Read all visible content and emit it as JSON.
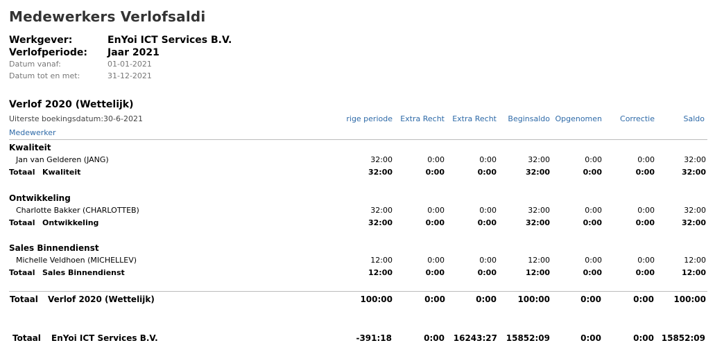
{
  "title": "Medewerkers Verlofsaldi",
  "meta": {
    "werkgever_label": "Werkgever:",
    "werkgever_value": "EnYoi ICT Services B.V.",
    "periode_label": "Verlofperiode:",
    "periode_value": "Jaar 2021",
    "van_label": "Datum vanaf:",
    "van_value": "01-01-2021",
    "tot_label": "Datum tot en met:",
    "tot_value": "31-12-2021"
  },
  "section": {
    "title": "Verlof 2020 (Wettelijk)",
    "boekingsdatum": "Uiterste boekingsdatum:30-6-2021",
    "employee_col": "Medewerker",
    "columns": [
      "rige periode",
      "Extra Recht",
      "Extra Recht",
      "Beginsaldo",
      "Opgenomen",
      "Correctie",
      "Saldo"
    ],
    "groups": [
      {
        "name": "Kwaliteit",
        "employee": "Jan van Gelderen (JANG)",
        "values": [
          "32:00",
          "0:00",
          "0:00",
          "32:00",
          "0:00",
          "0:00",
          "32:00"
        ],
        "total_label": "Totaal",
        "total_name": "Kwaliteit",
        "totals": [
          "32:00",
          "0:00",
          "0:00",
          "32:00",
          "0:00",
          "0:00",
          "32:00"
        ]
      },
      {
        "name": "Ontwikkeling",
        "employee": "Charlotte Bakker (CHARLOTTEB)",
        "values": [
          "32:00",
          "0:00",
          "0:00",
          "32:00",
          "0:00",
          "0:00",
          "32:00"
        ],
        "total_label": "Totaal",
        "total_name": "Ontwikkeling",
        "totals": [
          "32:00",
          "0:00",
          "0:00",
          "32:00",
          "0:00",
          "0:00",
          "32:00"
        ]
      },
      {
        "name": "Sales Binnendienst",
        "employee": "Michelle Veldhoen (MICHELLEV)",
        "values": [
          "12:00",
          "0:00",
          "0:00",
          "12:00",
          "0:00",
          "0:00",
          "12:00"
        ],
        "total_label": "Totaal",
        "total_name": "Sales Binnendienst",
        "totals": [
          "12:00",
          "0:00",
          "0:00",
          "12:00",
          "0:00",
          "0:00",
          "12:00"
        ]
      }
    ],
    "section_total_label": "Totaal",
    "section_total_name": "Verlof 2020 (Wettelijk)",
    "section_totals": [
      "100:00",
      "0:00",
      "0:00",
      "100:00",
      "0:00",
      "0:00",
      "100:00"
    ]
  },
  "grand": {
    "label": "Totaal",
    "name": "EnYoi ICT Services B.V.",
    "totals": [
      "-391:18",
      "0:00",
      "16243:27",
      "15852:09",
      "0:00",
      "0:00",
      "15852:09"
    ]
  }
}
